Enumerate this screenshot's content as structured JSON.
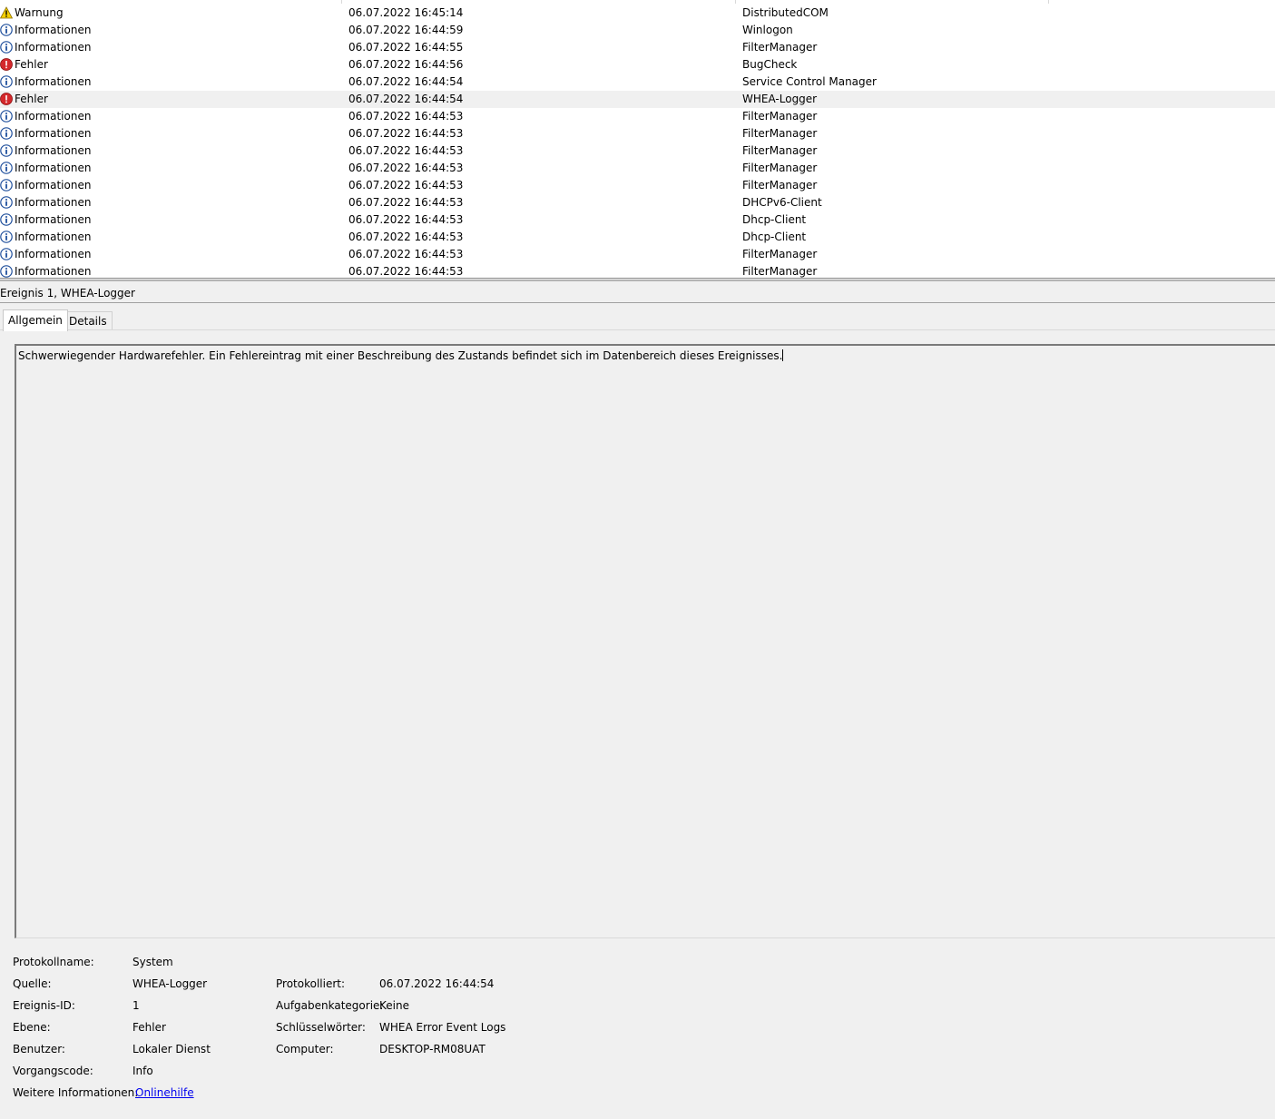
{
  "events": [
    {
      "level": "Warnung",
      "icon": "warning-icon",
      "date": "06.07.2022 16:45:14",
      "source": "DistributedCOM"
    },
    {
      "level": "Informationen",
      "icon": "info-icon",
      "date": "06.07.2022 16:44:59",
      "source": "Winlogon"
    },
    {
      "level": "Informationen",
      "icon": "info-icon",
      "date": "06.07.2022 16:44:55",
      "source": "FilterManager"
    },
    {
      "level": "Fehler",
      "icon": "error-icon",
      "date": "06.07.2022 16:44:56",
      "source": "BugCheck"
    },
    {
      "level": "Informationen",
      "icon": "info-icon",
      "date": "06.07.2022 16:44:54",
      "source": "Service Control Manager"
    },
    {
      "level": "Fehler",
      "icon": "error-icon",
      "date": "06.07.2022 16:44:54",
      "source": "WHEA-Logger",
      "selected": true
    },
    {
      "level": "Informationen",
      "icon": "info-icon",
      "date": "06.07.2022 16:44:53",
      "source": "FilterManager"
    },
    {
      "level": "Informationen",
      "icon": "info-icon",
      "date": "06.07.2022 16:44:53",
      "source": "FilterManager"
    },
    {
      "level": "Informationen",
      "icon": "info-icon",
      "date": "06.07.2022 16:44:53",
      "source": "FilterManager"
    },
    {
      "level": "Informationen",
      "icon": "info-icon",
      "date": "06.07.2022 16:44:53",
      "source": "FilterManager"
    },
    {
      "level": "Informationen",
      "icon": "info-icon",
      "date": "06.07.2022 16:44:53",
      "source": "FilterManager"
    },
    {
      "level": "Informationen",
      "icon": "info-icon",
      "date": "06.07.2022 16:44:53",
      "source": "DHCPv6-Client"
    },
    {
      "level": "Informationen",
      "icon": "info-icon",
      "date": "06.07.2022 16:44:53",
      "source": "Dhcp-Client"
    },
    {
      "level": "Informationen",
      "icon": "info-icon",
      "date": "06.07.2022 16:44:53",
      "source": "Dhcp-Client"
    },
    {
      "level": "Informationen",
      "icon": "info-icon",
      "date": "06.07.2022 16:44:53",
      "source": "FilterManager"
    },
    {
      "level": "Informationen",
      "icon": "info-icon",
      "date": "06.07.2022 16:44:53",
      "source": "FilterManager"
    }
  ],
  "detail": {
    "title": "Ereignis 1, WHEA-Logger",
    "tabs": [
      "Allgemein",
      "Details"
    ],
    "description": "Schwerwiegender Hardwarefehler. Ein Fehlereintrag mit einer Beschreibung des Zustands befindet sich im Datenbereich dieses Ereignisses.",
    "properties": {
      "log_name_label": "Protokollname:",
      "log_name": "System",
      "source_label": "Quelle:",
      "source": "WHEA-Logger",
      "logged_label": "Protokolliert:",
      "logged": "06.07.2022 16:44:54",
      "event_id_label": "Ereignis-ID:",
      "event_id": "1",
      "task_category_label": "Aufgabenkategorie:",
      "task_category": "Keine",
      "level_label": "Ebene:",
      "level": "Fehler",
      "keywords_label": "Schlüsselwörter:",
      "keywords": "WHEA Error Event Logs",
      "user_label": "Benutzer:",
      "user": "Lokaler Dienst",
      "computer_label": "Computer:",
      "computer": "DESKTOP-RM08UAT",
      "opcode_label": "Vorgangscode:",
      "opcode": "Info",
      "more_info_label": "Weitere Informationen:",
      "more_info_link": "Onlinehilfe"
    }
  }
}
